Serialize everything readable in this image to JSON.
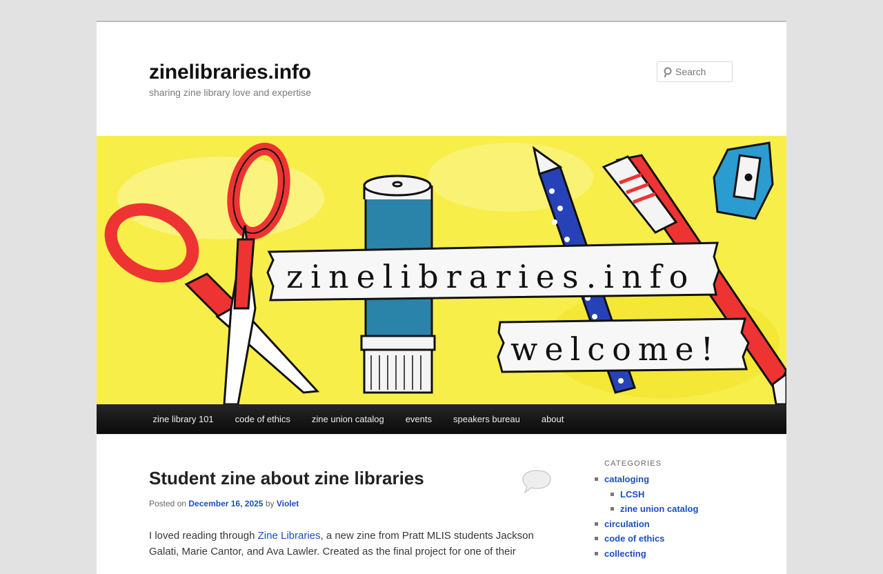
{
  "header": {
    "site_title": "zinelibraries.info",
    "tagline": "sharing zine library love and expertise",
    "search_placeholder": "Search"
  },
  "banner": {
    "line1": "zinelibraries.info",
    "line2": "welcome!"
  },
  "nav": {
    "items": [
      "zine library 101",
      "code of ethics",
      "zine union catalog",
      "events",
      "speakers bureau",
      "about"
    ]
  },
  "post": {
    "title": "Student zine about zine libraries",
    "posted_on": "Posted on",
    "date": "December 16, 2025",
    "by": "by",
    "author": "Violet",
    "intro": "I loved reading through ",
    "link": "Zine Libraries",
    "rest": ", a new zine from Pratt MLIS students Jackson Galati, Marie Cantor, and Ava Lawler. Created as the final project for one of their"
  },
  "sidebar": {
    "title": "CATEGORIES",
    "items": [
      "cataloging",
      "LCSH",
      "zine union catalog",
      "circulation",
      "code of ethics",
      "collecting"
    ]
  },
  "colors": {
    "link": "#1b4fbd",
    "nav_bg": "#1a1a1a",
    "banner_bg": "#f7ee4a"
  }
}
